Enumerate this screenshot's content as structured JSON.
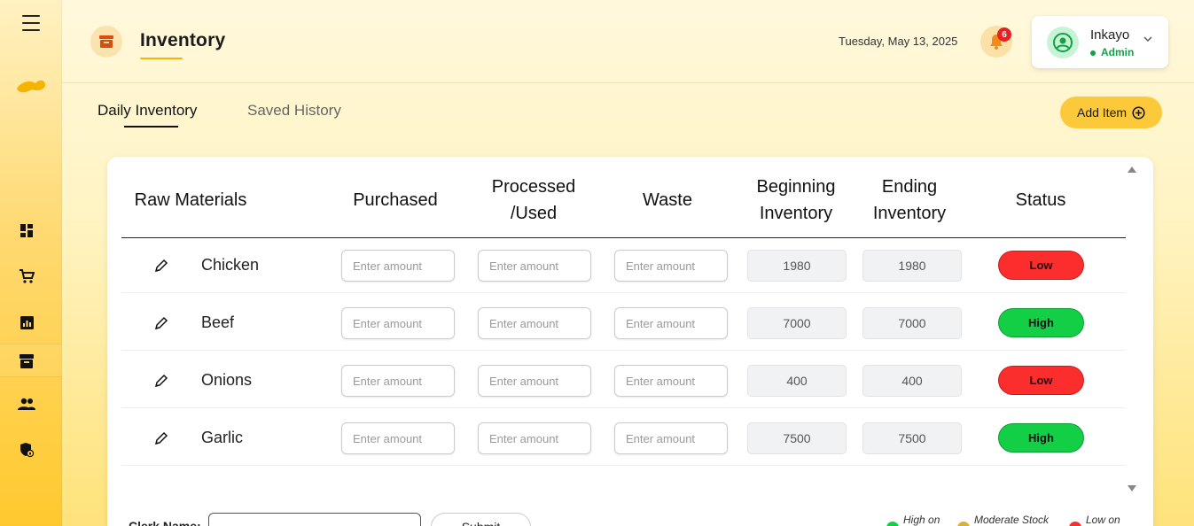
{
  "header": {
    "title": "Inventory",
    "date": "Tuesday, May 13, 2025",
    "notification_count": "6",
    "user": {
      "name": "Inkayo",
      "role": "Admin"
    }
  },
  "sidebar": {
    "items": [
      {
        "icon": "dashboard-icon"
      },
      {
        "icon": "cart-icon"
      },
      {
        "icon": "report-icon"
      },
      {
        "icon": "archive-icon",
        "active": true
      },
      {
        "icon": "users-icon"
      },
      {
        "icon": "security-icon"
      }
    ]
  },
  "tabs": {
    "daily": "Daily Inventory",
    "saved": "Saved History"
  },
  "toolbar": {
    "add_item": "Add Item"
  },
  "table": {
    "headers": {
      "raw_materials": "Raw Materials",
      "purchased": "Purchased",
      "processed_1": "Processed",
      "processed_2": "/Used",
      "waste": "Waste",
      "beginning_1": "Beginning",
      "beginning_2": "Inventory",
      "ending_1": "Ending",
      "ending_2": "Inventory",
      "status": "Status"
    },
    "placeholder": "Enter amount",
    "rows": [
      {
        "name": "Chicken",
        "beginning": "1980",
        "ending": "1980",
        "status": "Low"
      },
      {
        "name": "Beef",
        "beginning": "7000",
        "ending": "7000",
        "status": "High"
      },
      {
        "name": "Onions",
        "beginning": "400",
        "ending": "400",
        "status": "Low"
      },
      {
        "name": "Garlic",
        "beginning": "7500",
        "ending": "7500",
        "status": "High"
      }
    ]
  },
  "footer": {
    "clerk_label": "Clerk Name:",
    "submit": "Submit",
    "legend": {
      "high": "High on",
      "moderate": "Moderate Stock",
      "low": "Low on"
    }
  },
  "colors": {
    "accent": "#fcc93a",
    "low": "#fb2d2d",
    "high": "#13cf45",
    "moderate": "#d4b23c"
  }
}
